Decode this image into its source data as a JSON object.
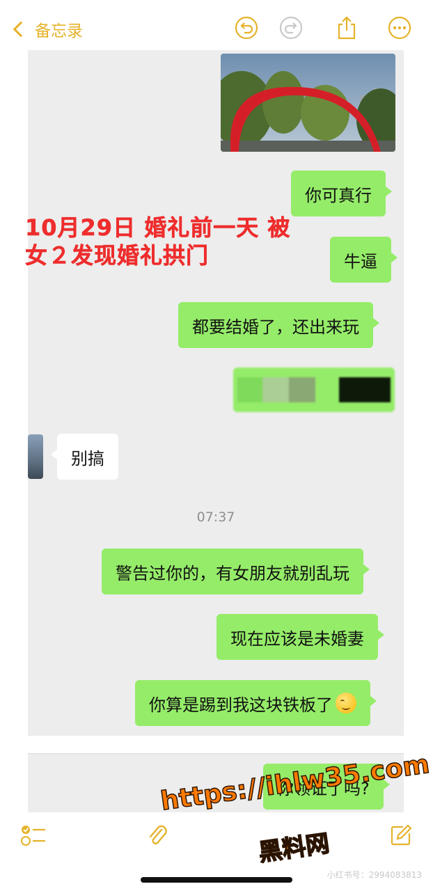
{
  "nav": {
    "back_label": "备忘录"
  },
  "chat": {
    "messages": [
      {
        "text": "你可真行"
      },
      {
        "text": "牛逼"
      },
      {
        "text": "都要结婚了，还出来玩"
      },
      {
        "text": "别搞"
      },
      {
        "text": "警告过你的，有女朋友就别乱玩"
      },
      {
        "text": "现在应该是未婚妻"
      },
      {
        "text": "你算是踢到我这块铁板了"
      },
      {
        "text": "你领证了吗?"
      }
    ],
    "timestamp": "07:37"
  },
  "overlay": {
    "line1": "10月29日 婚礼前一天 被",
    "line2": "女２发现婚礼拱门"
  },
  "watermark": {
    "url": "https://ihlw35.com",
    "site": "黑料网",
    "xhs": "小红书号：2994083813"
  },
  "colors": {
    "accent": "#e5b22a",
    "bubble_green": "#95ec69",
    "overlay_red": "#ee2d2d"
  },
  "icons": {
    "back": "chevron-left-icon",
    "undo": "undo-icon",
    "redo": "redo-icon",
    "share": "share-icon",
    "more": "more-icon",
    "checklist": "checklist-icon",
    "attach": "paperclip-icon",
    "compose": "compose-icon"
  }
}
